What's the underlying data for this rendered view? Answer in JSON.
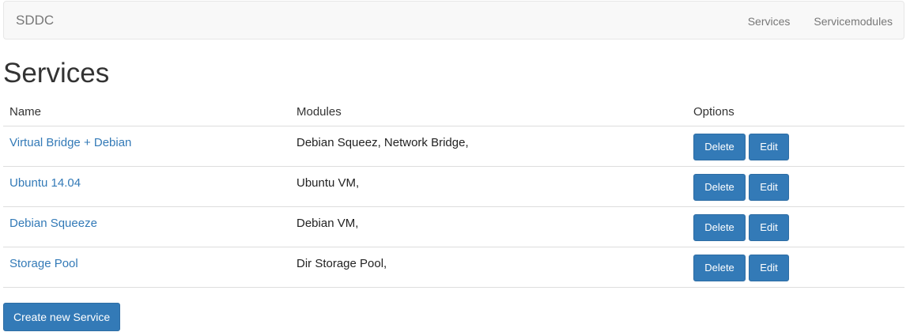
{
  "navbar": {
    "brand": "SDDC",
    "links": [
      "Services",
      "Servicemodules"
    ]
  },
  "page": {
    "title": "Services"
  },
  "table": {
    "headers": {
      "name": "Name",
      "modules": "Modules",
      "options": "Options"
    },
    "rows": [
      {
        "name": "Virtual Bridge + Debian",
        "modules": "Debian Squeez, Network Bridge,",
        "delete": "Delete",
        "edit": "Edit"
      },
      {
        "name": "Ubuntu 14.04",
        "modules": "Ubuntu VM,",
        "delete": "Delete",
        "edit": "Edit"
      },
      {
        "name": "Debian Squeeze",
        "modules": "Debian VM,",
        "delete": "Delete",
        "edit": "Edit"
      },
      {
        "name": "Storage Pool",
        "modules": "Dir Storage Pool,",
        "delete": "Delete",
        "edit": "Edit"
      }
    ]
  },
  "actions": {
    "create_label": "Create new Service"
  },
  "colors": {
    "primary": "#337ab7",
    "link": "#337ab7",
    "navbar_bg": "#f8f8f8"
  }
}
